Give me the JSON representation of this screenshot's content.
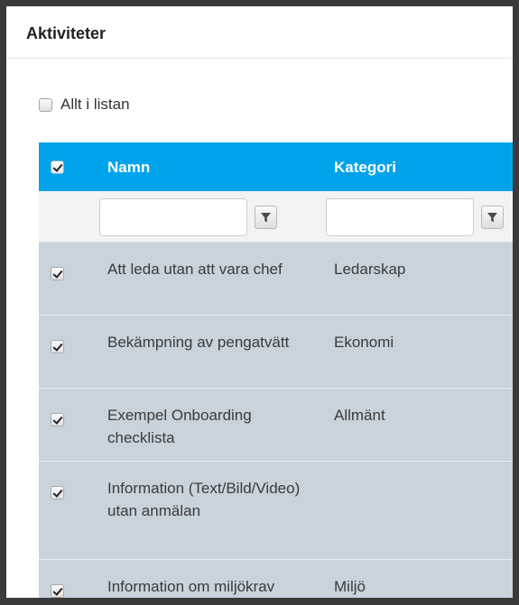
{
  "panel": {
    "title": "Aktiviteter"
  },
  "select_all": {
    "label": "Allt i listan",
    "checked": false
  },
  "grid": {
    "columns": {
      "name": "Namn",
      "category": "Kategori"
    },
    "header_checked": true,
    "filter_icon": "filter-funnel-icon",
    "rows": [
      {
        "name": "Att leda utan att vara chef",
        "category": "Ledarskap",
        "checked": true
      },
      {
        "name": "Bekämpning av pengatvätt",
        "category": "Ekonomi",
        "checked": true
      },
      {
        "name": "Exempel Onboarding checklista",
        "category": "Allmänt",
        "checked": true
      },
      {
        "name": "Information (Text/Bild/Video) utan anmälan",
        "category": "",
        "checked": true
      },
      {
        "name": "Information om miljökrav",
        "category": "Miljö",
        "checked": true
      }
    ]
  },
  "colors": {
    "header": "#00a3ea",
    "row": "#c8d3dc",
    "frame": "#3a3a3a"
  }
}
